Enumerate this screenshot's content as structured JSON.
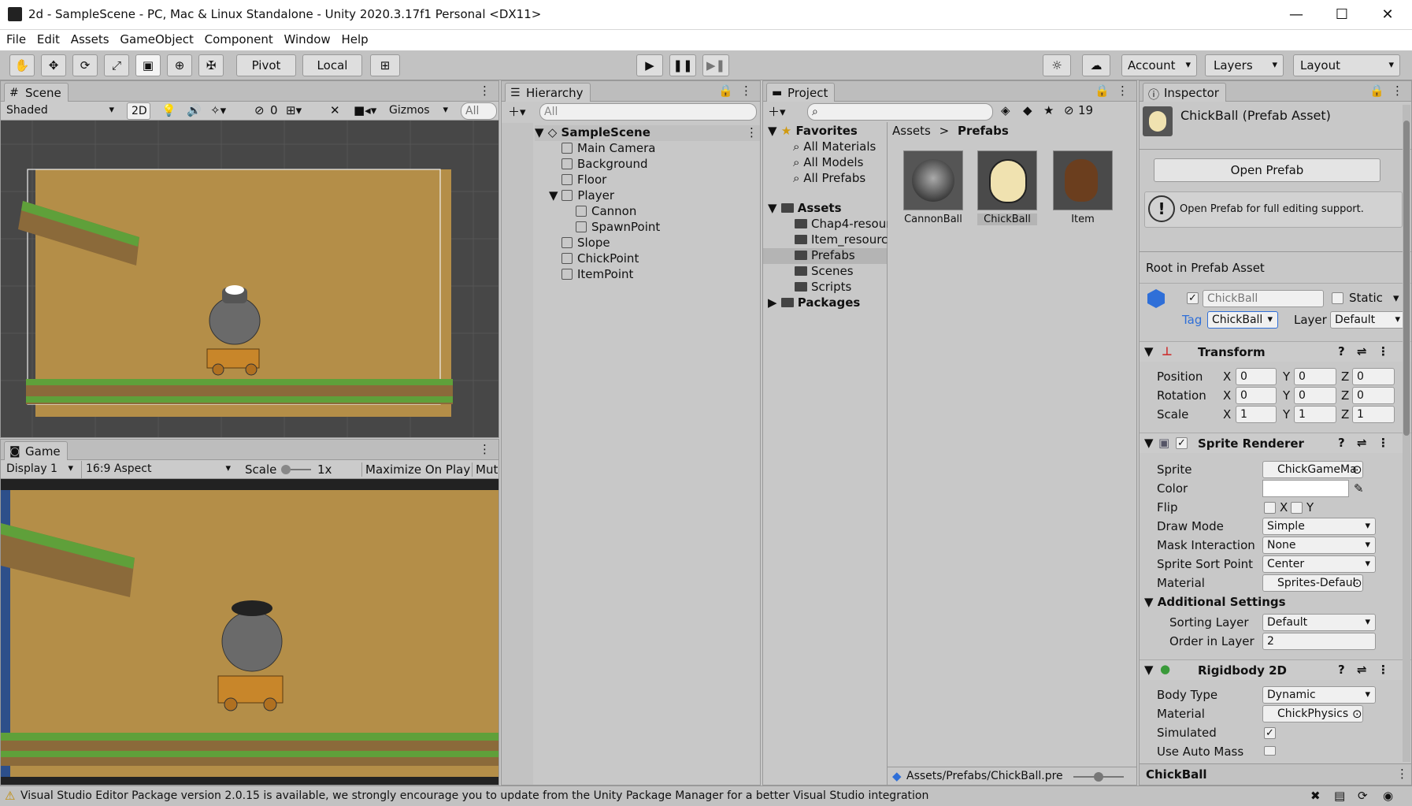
{
  "window": {
    "title": "2d - SampleScene - PC, Mac & Linux Standalone - Unity 2020.3.17f1 Personal <DX11>",
    "min": "—",
    "max": "☐",
    "close": "✕"
  },
  "menu": [
    "File",
    "Edit",
    "Assets",
    "GameObject",
    "Component",
    "Window",
    "Help"
  ],
  "toolbar": {
    "pivot": "Pivot",
    "local": "Local",
    "account": "Account",
    "layers": "Layers",
    "layout": "Layout"
  },
  "scene": {
    "tab": "Scene",
    "shading": "Shaded",
    "mode2d": "2D",
    "hidden_count": "0",
    "gizmos": "Gizmos",
    "search": "All"
  },
  "game": {
    "tab": "Game",
    "display": "Display 1",
    "aspect": "16:9 Aspect",
    "scale_label": "Scale",
    "scale_value": "1x",
    "maximize": "Maximize On Play",
    "mute": "Mute"
  },
  "hierarchy": {
    "tab": "Hierarchy",
    "search": "All",
    "scene": "SampleScene",
    "items": [
      "Main Camera",
      "Background",
      "Floor",
      "Player",
      "Cannon",
      "SpawnPoint",
      "Slope",
      "ChickPoint",
      "ItemPoint"
    ]
  },
  "project": {
    "tab": "Project",
    "hidden_count": "19",
    "favorites": "Favorites",
    "fav_items": [
      "All Materials",
      "All Models",
      "All Prefabs"
    ],
    "assets": "Assets",
    "asset_folders": [
      "Chap4-resour",
      "Item_resource",
      "Prefabs",
      "Scenes",
      "Scripts"
    ],
    "packages": "Packages",
    "crumb_root": "Assets",
    "crumb_sep": ">",
    "crumb_leaf": "Prefabs",
    "files": [
      "CannonBall",
      "ChickBall",
      "Item"
    ],
    "footer_path": "Assets/Prefabs/ChickBall.pre"
  },
  "inspector": {
    "tab": "Inspector",
    "title": "ChickBall (Prefab Asset)",
    "open_prefab": "Open Prefab",
    "help_text": "Open Prefab for full editing support.",
    "root_label": "Root in Prefab Asset",
    "name": "ChickBall",
    "static": "Static",
    "tag_label": "Tag",
    "tag": "ChickBall",
    "layer_label": "Layer",
    "layer": "Default",
    "transform": {
      "title": "Transform",
      "rows": [
        {
          "label": "Position",
          "x": "0",
          "y": "0",
          "z": "0"
        },
        {
          "label": "Rotation",
          "x": "0",
          "y": "0",
          "z": "0"
        },
        {
          "label": "Scale",
          "x": "1",
          "y": "1",
          "z": "1"
        }
      ]
    },
    "sprite_renderer": {
      "title": "Sprite Renderer",
      "sprite_label": "Sprite",
      "sprite": "ChickGameMa",
      "color_label": "Color",
      "flip_label": "Flip",
      "flip_x": "X",
      "flip_y": "Y",
      "draw_mode_label": "Draw Mode",
      "draw_mode": "Simple",
      "mask_label": "Mask Interaction",
      "mask": "None",
      "sort_point_label": "Sprite Sort Point",
      "sort_point": "Center",
      "material_label": "Material",
      "material": "Sprites-Defaul",
      "additional": "Additional Settings",
      "sorting_layer_label": "Sorting Layer",
      "sorting_layer": "Default",
      "order_label": "Order in Layer",
      "order": "2"
    },
    "rigidbody": {
      "title": "Rigidbody 2D",
      "body_type_label": "Body Type",
      "body_type": "Dynamic",
      "material_label": "Material",
      "material": "ChickPhysics",
      "simulated_label": "Simulated",
      "auto_mass_label": "Use Auto Mass"
    },
    "footer": "ChickBall"
  },
  "status": {
    "message": "Visual Studio Editor Package version 2.0.15 is available, we strongly encourage you to update from the Unity Package Manager for a better Visual Studio integration"
  },
  "colors": {
    "ground": "#b48e48",
    "grass": "#5fa03a",
    "accent": "#2f6fd8"
  }
}
